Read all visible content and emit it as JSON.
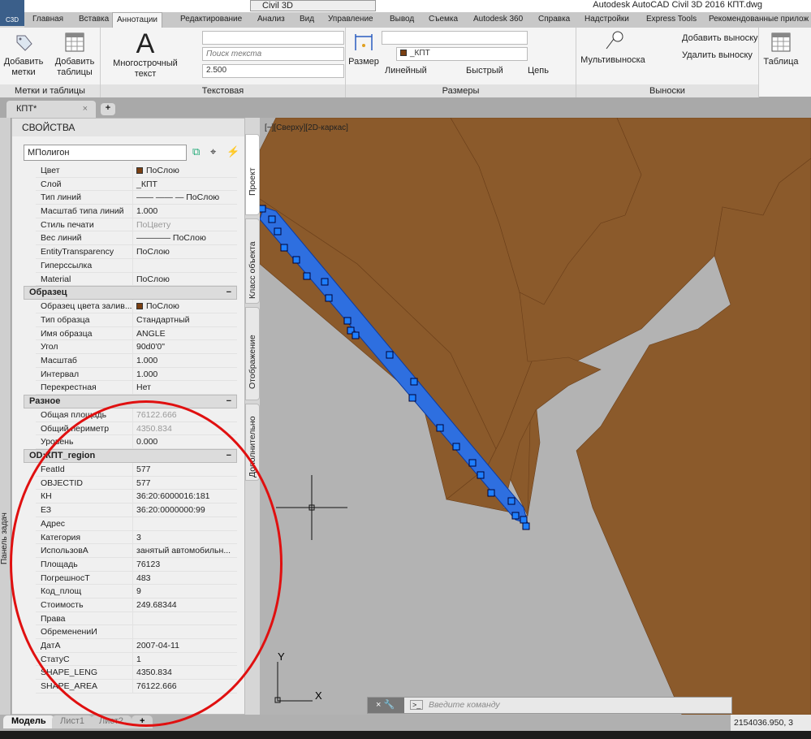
{
  "window": {
    "title": "Autodesk AutoCAD Civil 3D 2016    КПТ.dwg",
    "app_badge": "C3D",
    "workspace": "Civil 3D"
  },
  "ribbon_tabs": [
    "Главная",
    "Вставка",
    "Аннотации",
    "Редактирование",
    "Анализ",
    "Вид",
    "Управление",
    "Вывод",
    "Съемка",
    "Autodesk 360",
    "Справка",
    "Надстройки",
    "Express Tools",
    "Рекомендованные прилож"
  ],
  "active_tab": "Аннотации",
  "ribbon": {
    "labels_panel": {
      "title": "Метки и таблицы",
      "add_labels": "Добавить\nметки",
      "add_tables": "Добавить\nтаблицы"
    },
    "text_panel": {
      "title": "Текстовая",
      "mtext": "Многострочный\nтекст",
      "search_placeholder": "Поиск текста",
      "text_height": "2.500",
      "glyph": "A"
    },
    "dim_panel": {
      "title": "Размеры",
      "dimension": "Размер",
      "layer": "_КПТ",
      "linear": "Линейный",
      "quick": "Быстрый",
      "chain": "Цепь"
    },
    "leaders_panel": {
      "title": "Выноски",
      "multileader": "Мультивыноска",
      "add_leader": "Добавить выноску",
      "remove_leader": "Удалить выноску"
    },
    "table_panel": {
      "table": "Таблица"
    }
  },
  "doc_tab": {
    "name": "КПТ*",
    "close": "×",
    "new": "+"
  },
  "task_panel_label": "Панель задач",
  "properties": {
    "title": "СВОЙСТВА",
    "object_type": "МПолигон",
    "general": [
      {
        "k": "Цвет",
        "v": "ПоСлою",
        "swatch": true
      },
      {
        "k": "Слой",
        "v": "_КПТ"
      },
      {
        "k": "Тип линий",
        "v": "—— —— — ПоСлою"
      },
      {
        "k": "Масштаб типа линий",
        "v": "1.000"
      },
      {
        "k": "Стиль печати",
        "v": "ПоЦвету",
        "dim": true
      },
      {
        "k": "Вес линий",
        "v": "———— ПоСлою"
      },
      {
        "k": "EntityTransparency",
        "v": "ПоСлою"
      },
      {
        "k": "Гиперссылка",
        "v": ""
      },
      {
        "k": "Material",
        "v": "ПоСлою"
      }
    ],
    "sections": [
      {
        "title": "Образец",
        "rows": [
          {
            "k": "Образец  цвета  залив...",
            "v": "ПоСлою",
            "swatch": true
          },
          {
            "k": "Тип образца",
            "v": "Стандартный"
          },
          {
            "k": "Имя образца",
            "v": "ANGLE"
          },
          {
            "k": "Угол",
            "v": "90d0'0\""
          },
          {
            "k": "Масштаб",
            "v": "1.000"
          },
          {
            "k": "Интервал",
            "v": "1.000"
          },
          {
            "k": "Перекрестная",
            "v": "Нет"
          }
        ]
      },
      {
        "title": "Разное",
        "rows": [
          {
            "k": "Общая площадь",
            "v": "76122.666",
            "dim": true
          },
          {
            "k": "Общий периметр",
            "v": "4350.834",
            "dim": true
          },
          {
            "k": "Уровень",
            "v": "0.000"
          }
        ]
      },
      {
        "title": "OD:КПТ_region",
        "rows": [
          {
            "k": "FeatId",
            "v": "577"
          },
          {
            "k": "OBJECTID",
            "v": "577"
          },
          {
            "k": "КН",
            "v": "36:20:6000016:181"
          },
          {
            "k": "ЕЗ",
            "v": "36:20:0000000:99"
          },
          {
            "k": "Адрес",
            "v": ""
          },
          {
            "k": "Категория",
            "v": "3"
          },
          {
            "k": "ИспользовА",
            "v": "занятый  автомобильн..."
          },
          {
            "k": "Площадь",
            "v": "76123"
          },
          {
            "k": "ПогрешносТ",
            "v": "483"
          },
          {
            "k": "Код_площ",
            "v": "9"
          },
          {
            "k": "Стоимость",
            "v": "249.68344"
          },
          {
            "k": "Права",
            "v": ""
          },
          {
            "k": "ОбременениИ",
            "v": ""
          },
          {
            "k": "ДатА",
            "v": "2007-04-11"
          },
          {
            "k": "СтатуС",
            "v": "1"
          },
          {
            "k": "SHAPE_LENG",
            "v": "4350.834"
          },
          {
            "k": "SHAPE_AREA",
            "v": "76122.666"
          }
        ]
      }
    ],
    "collapse": "−"
  },
  "side_tabs": [
    "Проект",
    "Класс объекта",
    "Отображение",
    "Дополнительно"
  ],
  "viewport": {
    "label": "[−][Сверху][2D-каркас]",
    "ucs_x": "X",
    "ucs_y": "Y",
    "fill_color": "#8b5a2b",
    "bg_color": "#b3b3b3",
    "selection_color": "#2e6fe0"
  },
  "command_line": {
    "placeholder": "Введите команду",
    "close": "×",
    "prompt": ">_"
  },
  "layout_tabs": [
    "Модель",
    "Лист1",
    "Лист2",
    "+"
  ],
  "status": {
    "coords": "2154036.950, 3"
  },
  "annotation_color": "#e01010"
}
